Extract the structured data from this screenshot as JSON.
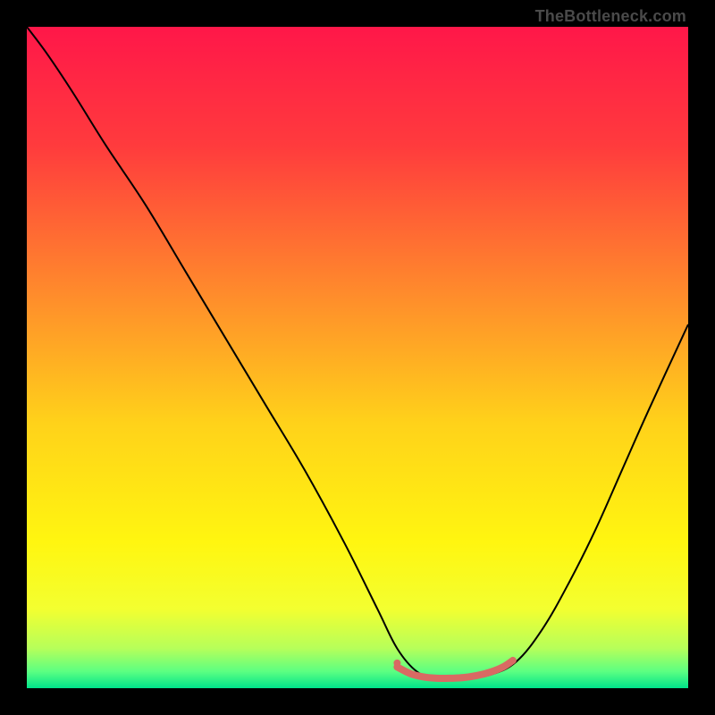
{
  "attribution": "TheBottleneck.com",
  "chart_data": {
    "type": "line",
    "title": "",
    "xlabel": "",
    "ylabel": "",
    "xlim": [
      0,
      100
    ],
    "ylim": [
      0,
      100
    ],
    "background_gradient": {
      "stops": [
        {
          "pos": 0.0,
          "color": "#ff1749"
        },
        {
          "pos": 0.18,
          "color": "#ff3b3d"
        },
        {
          "pos": 0.4,
          "color": "#ff8a2c"
        },
        {
          "pos": 0.6,
          "color": "#ffd21a"
        },
        {
          "pos": 0.78,
          "color": "#fff610"
        },
        {
          "pos": 0.88,
          "color": "#f3ff30"
        },
        {
          "pos": 0.94,
          "color": "#b6ff5a"
        },
        {
          "pos": 0.975,
          "color": "#5bff82"
        },
        {
          "pos": 1.0,
          "color": "#00e38a"
        }
      ]
    },
    "series": [
      {
        "name": "bottleneck-curve",
        "stroke": "#000000",
        "stroke_width": 2,
        "x": [
          0,
          3,
          7,
          12,
          18,
          24,
          30,
          36,
          42,
          48,
          53,
          56,
          59,
          62,
          66,
          70,
          74,
          78,
          82,
          86,
          90,
          94,
          100
        ],
        "y": [
          100,
          96,
          90,
          82,
          73,
          63,
          53,
          43,
          33,
          22,
          12,
          6,
          2.5,
          1.5,
          1.5,
          2,
          4,
          9,
          16,
          24,
          33,
          42,
          55
        ]
      }
    ],
    "flat_region_marker": {
      "stroke": "#d96a63",
      "stroke_width": 8,
      "points_x": [
        56,
        58,
        60,
        62,
        64,
        66,
        68,
        70,
        72,
        73.5
      ],
      "points_y": [
        3.2,
        2.2,
        1.7,
        1.5,
        1.5,
        1.6,
        1.9,
        2.4,
        3.2,
        4.2
      ],
      "end_dot": {
        "x": 56,
        "y": 3.8,
        "r": 4
      }
    }
  }
}
